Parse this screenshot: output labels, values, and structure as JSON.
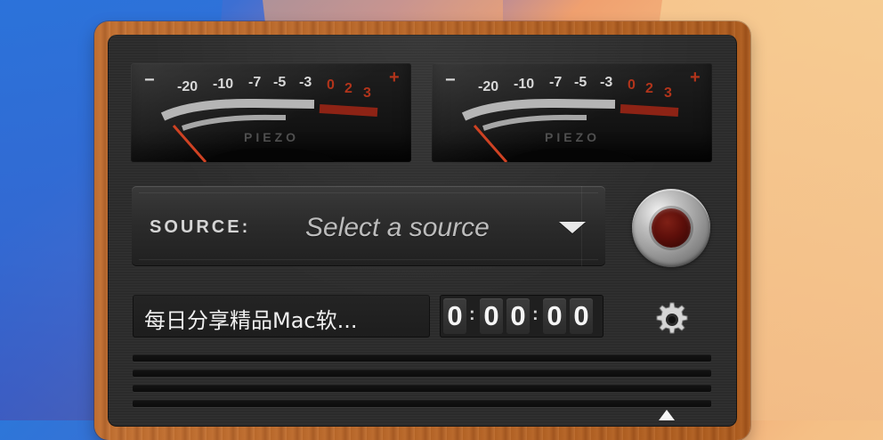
{
  "meter_left": {
    "minus": "−",
    "scale": [
      "-20",
      "-10",
      "-7",
      "-5",
      "-3"
    ],
    "red_scale": [
      "0",
      "2",
      "3"
    ],
    "plus": "+",
    "brand": "PIEZO"
  },
  "meter_right": {
    "minus": "−",
    "scale": [
      "-20",
      "-10",
      "-7",
      "-5",
      "-3"
    ],
    "red_scale": [
      "0",
      "2",
      "3"
    ],
    "plus": "+",
    "brand": "PIEZO"
  },
  "source": {
    "label": "SOURCE:",
    "value": "Select a source"
  },
  "title_field": {
    "text": "每日分享精品Mac软..."
  },
  "timer": {
    "digits": [
      "0",
      "0",
      "0",
      "0",
      "0"
    ],
    "separators": [
      ":",
      ":"
    ]
  },
  "icons": {
    "settings": "gear-icon",
    "dropdown": "chevron-down-icon",
    "record": "record-icon",
    "arrow": "arrow-up-icon"
  },
  "colors": {
    "wood": "#bf6826",
    "panel": "#2c2c2c",
    "record_red": "#6a120c"
  }
}
